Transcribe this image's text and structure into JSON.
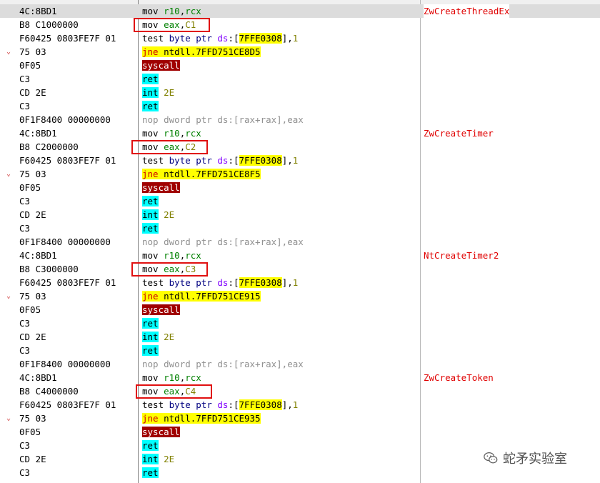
{
  "watermark": {
    "text": "蛇矛实验室",
    "icon": "wechat-icon"
  },
  "blocks": [
    {
      "syscall_name": "ZwCreateThreadEx",
      "lines": [
        {
          "marker": "",
          "bytes": "4C:8BD1",
          "kind": "mov_r10",
          "a": "mov",
          "b": "r10",
          "c": "rcx"
        },
        {
          "marker": "",
          "bytes": "B8 C1000000",
          "kind": "mov_eax",
          "a": "mov",
          "b": "eax",
          "c": "C1"
        },
        {
          "marker": "",
          "bytes": "F60425 0803FE7F 01",
          "kind": "test",
          "a": "test",
          "b": "byte",
          "c": "ptr",
          "d": "ds",
          "e": "7FFE0308",
          "f": "1"
        },
        {
          "marker": "⌄",
          "bytes": "75 03",
          "kind": "jne",
          "a": "jne",
          "b": "ntdll.7FFD751CE8D5"
        },
        {
          "marker": "",
          "bytes": "0F05",
          "kind": "syscall",
          "a": "syscall"
        },
        {
          "marker": "",
          "bytes": "C3",
          "kind": "ret",
          "a": "ret"
        },
        {
          "marker": "",
          "bytes": "CD 2E",
          "kind": "int",
          "a": "int",
          "b": "2E"
        },
        {
          "marker": "",
          "bytes": "C3",
          "kind": "ret",
          "a": "ret"
        },
        {
          "marker": "",
          "bytes": "0F1F8400 00000000",
          "kind": "nop",
          "a": "nop dword ptr ds:[rax+rax],eax"
        }
      ]
    },
    {
      "syscall_name": "ZwCreateTimer",
      "lines": [
        {
          "marker": "",
          "bytes": "4C:8BD1",
          "kind": "mov_r10",
          "a": "mov",
          "b": "r10",
          "c": "rcx"
        },
        {
          "marker": "",
          "bytes": "B8 C2000000",
          "kind": "mov_eax",
          "a": "mov",
          "b": "eax",
          "c": "C2"
        },
        {
          "marker": "",
          "bytes": "F60425 0803FE7F 01",
          "kind": "test",
          "a": "test",
          "b": "byte",
          "c": "ptr",
          "d": "ds",
          "e": "7FFE0308",
          "f": "1"
        },
        {
          "marker": "⌄",
          "bytes": "75 03",
          "kind": "jne",
          "a": "jne",
          "b": "ntdll.7FFD751CE8F5"
        },
        {
          "marker": "",
          "bytes": "0F05",
          "kind": "syscall",
          "a": "syscall"
        },
        {
          "marker": "",
          "bytes": "C3",
          "kind": "ret",
          "a": "ret"
        },
        {
          "marker": "",
          "bytes": "CD 2E",
          "kind": "int",
          "a": "int",
          "b": "2E"
        },
        {
          "marker": "",
          "bytes": "C3",
          "kind": "ret",
          "a": "ret"
        },
        {
          "marker": "",
          "bytes": "0F1F8400 00000000",
          "kind": "nop",
          "a": "nop dword ptr ds:[rax+rax],eax"
        }
      ]
    },
    {
      "syscall_name": "NtCreateTimer2",
      "lines": [
        {
          "marker": "",
          "bytes": "4C:8BD1",
          "kind": "mov_r10",
          "a": "mov",
          "b": "r10",
          "c": "rcx"
        },
        {
          "marker": "",
          "bytes": "B8 C3000000",
          "kind": "mov_eax",
          "a": "mov",
          "b": "eax",
          "c": "C3"
        },
        {
          "marker": "",
          "bytes": "F60425 0803FE7F 01",
          "kind": "test",
          "a": "test",
          "b": "byte",
          "c": "ptr",
          "d": "ds",
          "e": "7FFE0308",
          "f": "1"
        },
        {
          "marker": "⌄",
          "bytes": "75 03",
          "kind": "jne",
          "a": "jne",
          "b": "ntdll.7FFD751CE915"
        },
        {
          "marker": "",
          "bytes": "0F05",
          "kind": "syscall",
          "a": "syscall"
        },
        {
          "marker": "",
          "bytes": "C3",
          "kind": "ret",
          "a": "ret"
        },
        {
          "marker": "",
          "bytes": "CD 2E",
          "kind": "int",
          "a": "int",
          "b": "2E"
        },
        {
          "marker": "",
          "bytes": "C3",
          "kind": "ret",
          "a": "ret"
        },
        {
          "marker": "",
          "bytes": "0F1F8400 00000000",
          "kind": "nop",
          "a": "nop dword ptr ds:[rax+rax],eax"
        }
      ]
    },
    {
      "syscall_name": "ZwCreateToken",
      "lines": [
        {
          "marker": "",
          "bytes": "4C:8BD1",
          "kind": "mov_r10",
          "a": "mov",
          "b": "r10",
          "c": "rcx"
        },
        {
          "marker": "",
          "bytes": "B8 C4000000",
          "kind": "mov_eax",
          "a": "mov",
          "b": "eax",
          "c": "C4"
        },
        {
          "marker": "",
          "bytes": "F60425 0803FE7F 01",
          "kind": "test",
          "a": "test",
          "b": "byte",
          "c": "ptr",
          "d": "ds",
          "e": "7FFE0308",
          "f": "1"
        },
        {
          "marker": "⌄",
          "bytes": "75 03",
          "kind": "jne",
          "a": "jne",
          "b": "ntdll.7FFD751CE935"
        },
        {
          "marker": "",
          "bytes": "0F05",
          "kind": "syscall",
          "a": "syscall"
        },
        {
          "marker": "",
          "bytes": "C3",
          "kind": "ret",
          "a": "ret"
        },
        {
          "marker": "",
          "bytes": "CD 2E",
          "kind": "int",
          "a": "int",
          "b": "2E"
        },
        {
          "marker": "",
          "bytes": "C3",
          "kind": "ret",
          "a": "ret"
        }
      ]
    }
  ]
}
